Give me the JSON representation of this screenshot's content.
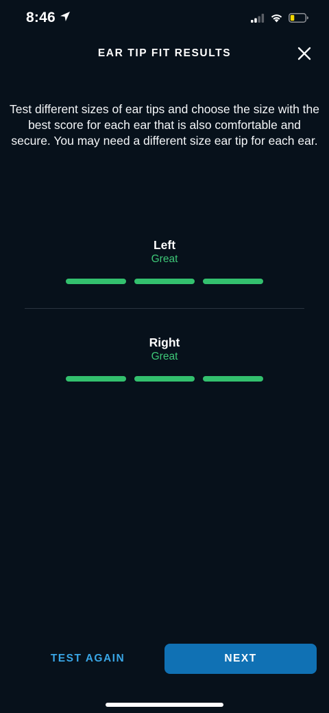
{
  "status_bar": {
    "time": "8:46",
    "icons": [
      "location-arrow-icon",
      "cellular-signal-icon",
      "wifi-icon",
      "battery-low-icon"
    ],
    "battery_color": "#f2d600"
  },
  "header": {
    "title": "EAR TIP FIT RESULTS",
    "close_icon": "close-icon"
  },
  "description": "Test different sizes of ear tips and choose the size with the best score for each ear that is also comfortable and secure. You may need a different size ear tip for each ear.",
  "results": {
    "left": {
      "label": "Left",
      "rating": "Great",
      "level": 3,
      "max_level": 3
    },
    "right": {
      "label": "Right",
      "rating": "Great",
      "level": 3,
      "max_level": 3
    }
  },
  "colors": {
    "background": "#07111b",
    "rating_green": "#3ec878",
    "bar_green": "#33c06e",
    "link_blue": "#39a6e6",
    "primary_button": "#1071b4"
  },
  "footer": {
    "test_again_label": "TEST AGAIN",
    "next_label": "NEXT"
  }
}
